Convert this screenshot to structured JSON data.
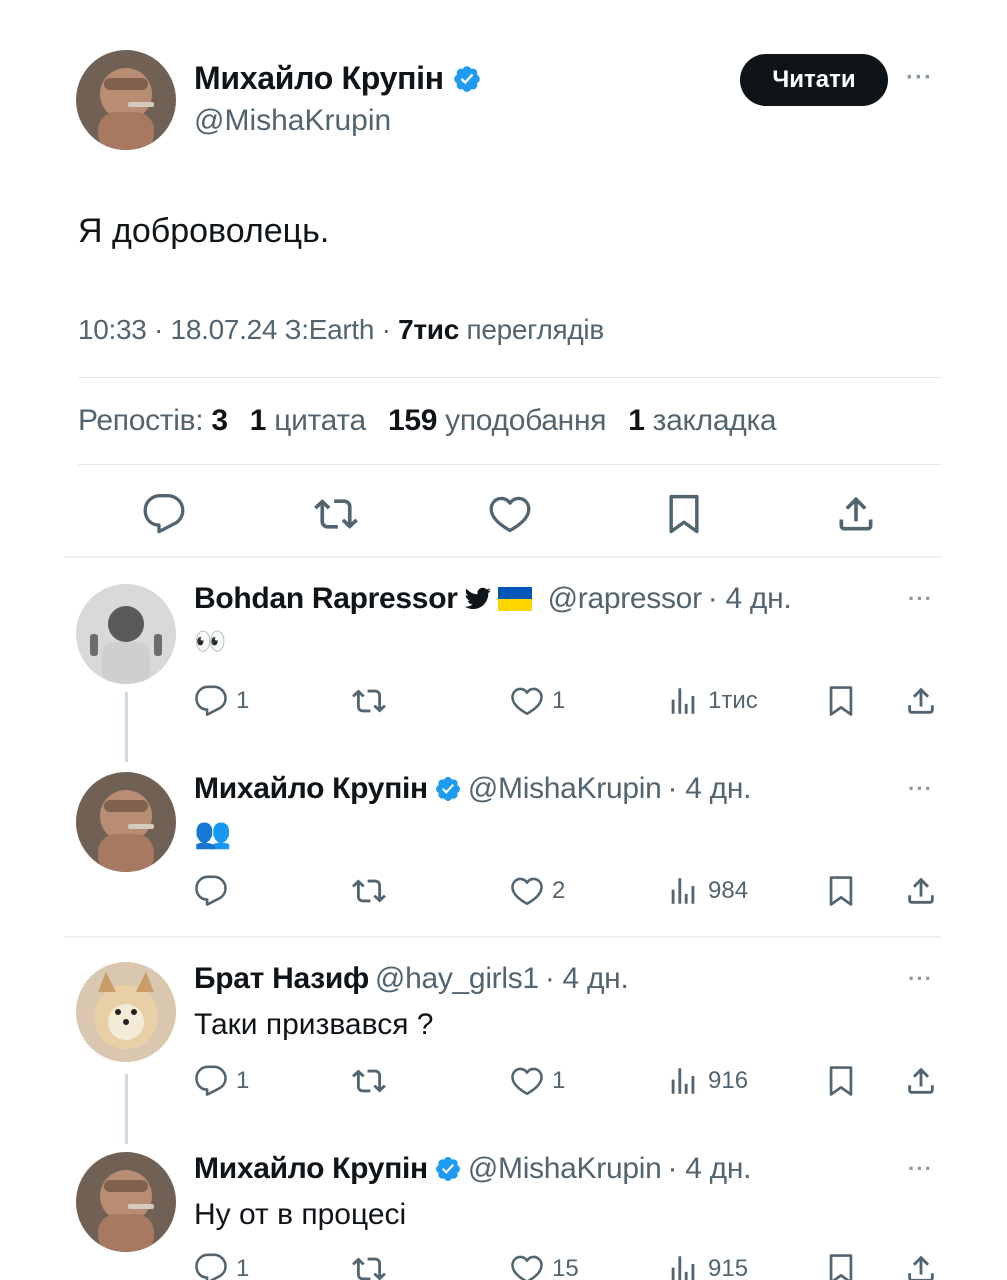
{
  "main_tweet": {
    "author_name": "Михайло Крупін",
    "author_handle": "@MishaKrupin",
    "follow_label": "Читати",
    "more_label": "···",
    "text": "Я доброволець.",
    "meta_prefix": "10:33 · 18.07.24 З:Earth · ",
    "views_count": "7тис",
    "views_label": "переглядів",
    "stats": {
      "reposts_label": "Репостів:",
      "reposts_count": "3",
      "quotes_count": "1",
      "quotes_label": "цитата",
      "likes_count": "159",
      "likes_label": "уподобання",
      "bookmarks_count": "1",
      "bookmarks_label": "закладка"
    },
    "actions": [
      "reply-icon",
      "repost-icon",
      "like-icon",
      "bookmark-icon",
      "share-icon"
    ]
  },
  "replies": [
    {
      "author_name": "Bohdan Rapressor",
      "author_handle": "@rapressor",
      "time": "· 4 дн.",
      "text": "👀",
      "reply_count": "1",
      "repost_count": "",
      "like_count": "1",
      "views": "1тис"
    },
    {
      "author_name": "Михайло Крупін",
      "author_handle": "@MishaKrupin",
      "time": "· 4 дн.",
      "text": "👥",
      "reply_count": "",
      "repost_count": "",
      "like_count": "2",
      "views": "984"
    },
    {
      "author_name": "Брат Назиф",
      "author_handle": "@hay_girls1",
      "time": "· 4 дн.",
      "text": "Таки призвався ?",
      "reply_count": "1",
      "repost_count": "",
      "like_count": "1",
      "views": "916"
    },
    {
      "author_name": "Михайло Крупін",
      "author_handle": "@MishaKrupin",
      "time": "· 4 дн.",
      "text": "Ну от в процесі",
      "reply_count": "1",
      "repost_count": "",
      "like_count": "15",
      "views": "915"
    }
  ],
  "colors": {
    "text": "#0f1419",
    "secondary": "#536471",
    "verified": "#1d9bf0",
    "divider": "#e7e9ea",
    "button_bg": "#0f1419"
  }
}
